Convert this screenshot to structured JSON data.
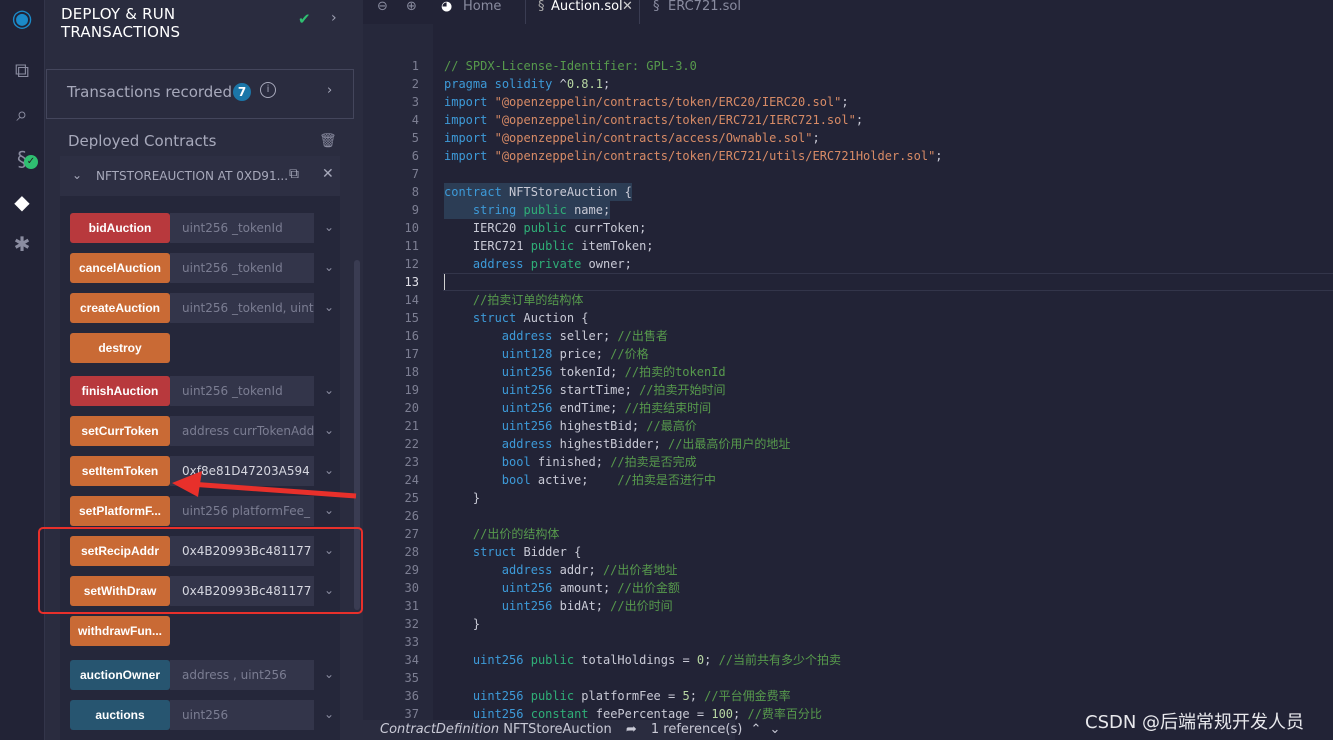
{
  "iconbar": {
    "items": [
      "remix-logo-icon",
      "file-explorer-icon",
      "search-icon",
      "solidity-compiler-icon",
      "deploy-run-icon",
      "debugger-icon"
    ]
  },
  "panel": {
    "title_line1": "DEPLOY & RUN",
    "title_line2": "TRANSACTIONS",
    "transactions_label": "Transactions recorded",
    "transactions_count": "7",
    "deployed_label": "Deployed Contracts",
    "contract_name": "NFTSTOREAUCTION AT 0XD91...",
    "functions": [
      {
        "name": "bidAuction",
        "kind": "payable",
        "placeholder": "uint256 _tokenId",
        "value": ""
      },
      {
        "name": "cancelAuction",
        "kind": "write",
        "placeholder": "uint256 _tokenId",
        "value": ""
      },
      {
        "name": "createAuction",
        "kind": "write",
        "placeholder": "uint256 _tokenId, uint1",
        "value": ""
      },
      {
        "name": "destroy",
        "kind": "write",
        "placeholder": null,
        "value": ""
      },
      {
        "name": "finishAuction",
        "kind": "payable",
        "placeholder": "uint256 _tokenId",
        "value": ""
      },
      {
        "name": "setCurrToken",
        "kind": "write",
        "placeholder": "address currTokenAdd",
        "value": ""
      },
      {
        "name": "setItemToken",
        "kind": "write",
        "placeholder": "",
        "value": "0xf8e81D47203A594"
      },
      {
        "name": "setPlatformF...",
        "kind": "write",
        "placeholder": "uint256 platformFee_",
        "value": ""
      },
      {
        "name": "setRecipAddr",
        "kind": "write",
        "placeholder": "",
        "value": "0x4B20993Bc481177"
      },
      {
        "name": "setWithDraw",
        "kind": "write",
        "placeholder": "",
        "value": "0x4B20993Bc481177"
      },
      {
        "name": "withdrawFun...",
        "kind": "write",
        "placeholder": null,
        "value": ""
      },
      {
        "name": "auctionOwner",
        "kind": "view",
        "placeholder": "address , uint256",
        "value": ""
      },
      {
        "name": "auctions",
        "kind": "view",
        "placeholder": "uint256",
        "value": ""
      }
    ]
  },
  "colors": {
    "payable": "#b8393d",
    "write": "#c96a35",
    "view": "#275570",
    "annotation": "#e8302b"
  },
  "tabs": [
    {
      "label": "Home",
      "icon": "home-icon"
    },
    {
      "label": "Auction.sol",
      "icon": "solidity-file-icon",
      "active": true
    },
    {
      "label": "ERC721.sol",
      "icon": "solidity-file-icon"
    }
  ],
  "editor": {
    "current_line": 13,
    "lines": [
      [
        [
          "c",
          "// SPDX-License-Identifier: GPL-3.0"
        ]
      ],
      [
        [
          "k",
          "pragma"
        ],
        [
          "t",
          " "
        ],
        [
          "k",
          "solidity"
        ],
        [
          "t",
          " ^"
        ],
        [
          "n",
          "0.8.1"
        ],
        [
          "t",
          ";"
        ]
      ],
      [
        [
          "k",
          "import"
        ],
        [
          "t",
          " "
        ],
        [
          "s",
          "\"@openzeppelin/contracts/token/ERC20/IERC20.sol\""
        ],
        [
          "t",
          ";"
        ]
      ],
      [
        [
          "k",
          "import"
        ],
        [
          "t",
          " "
        ],
        [
          "s",
          "\"@openzeppelin/contracts/token/ERC721/IERC721.sol\""
        ],
        [
          "t",
          ";"
        ]
      ],
      [
        [
          "k",
          "import"
        ],
        [
          "t",
          " "
        ],
        [
          "s",
          "\"@openzeppelin/contracts/access/Ownable.sol\""
        ],
        [
          "t",
          ";"
        ]
      ],
      [
        [
          "k",
          "import"
        ],
        [
          "t",
          " "
        ],
        [
          "s",
          "\"@openzeppelin/contracts/token/ERC721/utils/ERC721Holder.sol\""
        ],
        [
          "t",
          ";"
        ]
      ],
      [],
      [
        [
          "k",
          "contract"
        ],
        [
          "t",
          " NFTStoreAuction {"
        ]
      ],
      [
        [
          "t",
          "    "
        ],
        [
          "k",
          "string"
        ],
        [
          "t",
          " "
        ],
        [
          "m",
          "public"
        ],
        [
          "t",
          " name;"
        ]
      ],
      [
        [
          "t",
          "    IERC20 "
        ],
        [
          "m",
          "public"
        ],
        [
          "t",
          " currToken;"
        ]
      ],
      [
        [
          "t",
          "    IERC721 "
        ],
        [
          "m",
          "public"
        ],
        [
          "t",
          " itemToken;"
        ]
      ],
      [
        [
          "t",
          "    "
        ],
        [
          "k",
          "address"
        ],
        [
          "t",
          " "
        ],
        [
          "m",
          "private"
        ],
        [
          "t",
          " owner;"
        ]
      ],
      [],
      [
        [
          "t",
          "    "
        ],
        [
          "c",
          "//拍卖订单的结构体"
        ]
      ],
      [
        [
          "t",
          "    "
        ],
        [
          "k",
          "struct"
        ],
        [
          "t",
          " Auction {"
        ]
      ],
      [
        [
          "t",
          "        "
        ],
        [
          "k",
          "address"
        ],
        [
          "t",
          " seller; "
        ],
        [
          "c",
          "//出售者"
        ]
      ],
      [
        [
          "t",
          "        "
        ],
        [
          "k",
          "uint128"
        ],
        [
          "t",
          " price; "
        ],
        [
          "c",
          "//价格"
        ]
      ],
      [
        [
          "t",
          "        "
        ],
        [
          "k",
          "uint256"
        ],
        [
          "t",
          " tokenId; "
        ],
        [
          "c",
          "//拍卖的tokenId"
        ]
      ],
      [
        [
          "t",
          "        "
        ],
        [
          "k",
          "uint256"
        ],
        [
          "t",
          " startTime; "
        ],
        [
          "c",
          "//拍卖开始时间"
        ]
      ],
      [
        [
          "t",
          "        "
        ],
        [
          "k",
          "uint256"
        ],
        [
          "t",
          " endTime; "
        ],
        [
          "c",
          "//拍卖结束时间"
        ]
      ],
      [
        [
          "t",
          "        "
        ],
        [
          "k",
          "uint256"
        ],
        [
          "t",
          " highestBid; "
        ],
        [
          "c",
          "//最高价"
        ]
      ],
      [
        [
          "t",
          "        "
        ],
        [
          "k",
          "address"
        ],
        [
          "t",
          " highestBidder; "
        ],
        [
          "c",
          "//出最高价用户的地址"
        ]
      ],
      [
        [
          "t",
          "        "
        ],
        [
          "k",
          "bool"
        ],
        [
          "t",
          " finished; "
        ],
        [
          "c",
          "//拍卖是否完成"
        ]
      ],
      [
        [
          "t",
          "        "
        ],
        [
          "k",
          "bool"
        ],
        [
          "t",
          " active;    "
        ],
        [
          "c",
          "//拍卖是否进行中"
        ]
      ],
      [
        [
          "t",
          "    }"
        ]
      ],
      [],
      [
        [
          "t",
          "    "
        ],
        [
          "c",
          "//出价的结构体"
        ]
      ],
      [
        [
          "t",
          "    "
        ],
        [
          "k",
          "struct"
        ],
        [
          "t",
          " Bidder {"
        ]
      ],
      [
        [
          "t",
          "        "
        ],
        [
          "k",
          "address"
        ],
        [
          "t",
          " addr; "
        ],
        [
          "c",
          "//出价者地址"
        ]
      ],
      [
        [
          "t",
          "        "
        ],
        [
          "k",
          "uint256"
        ],
        [
          "t",
          " amount; "
        ],
        [
          "c",
          "//出价金额"
        ]
      ],
      [
        [
          "t",
          "        "
        ],
        [
          "k",
          "uint256"
        ],
        [
          "t",
          " bidAt; "
        ],
        [
          "c",
          "//出价时间"
        ]
      ],
      [
        [
          "t",
          "    }"
        ]
      ],
      [],
      [
        [
          "t",
          "    "
        ],
        [
          "k",
          "uint256"
        ],
        [
          "t",
          " "
        ],
        [
          "m",
          "public"
        ],
        [
          "t",
          " totalHoldings = "
        ],
        [
          "n",
          "0"
        ],
        [
          "t",
          "; "
        ],
        [
          "c",
          "//当前共有多少个拍卖"
        ]
      ],
      [],
      [
        [
          "t",
          "    "
        ],
        [
          "k",
          "uint256"
        ],
        [
          "t",
          " "
        ],
        [
          "m",
          "public"
        ],
        [
          "t",
          " platformFee = "
        ],
        [
          "n",
          "5"
        ],
        [
          "t",
          "; "
        ],
        [
          "c",
          "//平台佣金费率"
        ]
      ],
      [
        [
          "t",
          "    "
        ],
        [
          "k",
          "uint256"
        ],
        [
          "t",
          " "
        ],
        [
          "m",
          "constant"
        ],
        [
          "t",
          " feePercentage = "
        ],
        [
          "n",
          "100"
        ],
        [
          "t",
          "; "
        ],
        [
          "c",
          "//费率百分比"
        ]
      ]
    ]
  },
  "status": {
    "kind": "ContractDefinition",
    "name": "NFTStoreAuction",
    "references": "1 reference(s)"
  },
  "watermark": "CSDN @后端常规开发人员"
}
